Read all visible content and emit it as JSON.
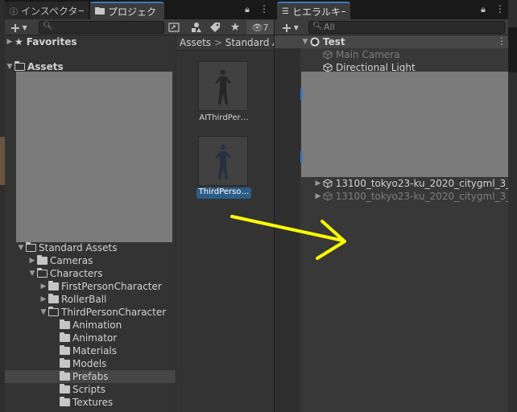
{
  "project": {
    "tabs": [
      {
        "label": "インスペクター",
        "icon": "info-icon"
      },
      {
        "label": "プロジェクト",
        "icon": "folder-icon"
      }
    ],
    "add_button": "+",
    "search_placeholder": "",
    "filter_count": "7",
    "favorites_label": "Favorites",
    "assets_label": "Assets",
    "breadcrumb": [
      "Assets",
      "Standard A"
    ],
    "tree": [
      {
        "label": "Standard Assets",
        "indent": 0,
        "expanded": true,
        "has_arrow": true
      },
      {
        "label": "Cameras",
        "indent": 1,
        "expanded": false,
        "has_arrow": true
      },
      {
        "label": "Characters",
        "indent": 1,
        "expanded": true,
        "has_arrow": true
      },
      {
        "label": "FirstPersonCharacter",
        "indent": 2,
        "expanded": false,
        "has_arrow": true
      },
      {
        "label": "RollerBall",
        "indent": 2,
        "expanded": false,
        "has_arrow": true
      },
      {
        "label": "ThirdPersonCharacter",
        "indent": 2,
        "expanded": true,
        "has_arrow": true
      },
      {
        "label": "Animation",
        "indent": 3,
        "expanded": false,
        "has_arrow": false
      },
      {
        "label": "Animator",
        "indent": 3,
        "expanded": false,
        "has_arrow": false
      },
      {
        "label": "Materials",
        "indent": 3,
        "expanded": false,
        "has_arrow": false
      },
      {
        "label": "Models",
        "indent": 3,
        "expanded": false,
        "has_arrow": false
      },
      {
        "label": "Prefabs",
        "indent": 3,
        "expanded": false,
        "has_arrow": false,
        "selected": true
      },
      {
        "label": "Scripts",
        "indent": 3,
        "expanded": false,
        "has_arrow": false
      },
      {
        "label": "Textures",
        "indent": 3,
        "expanded": false,
        "has_arrow": false
      }
    ],
    "assets": [
      {
        "label": "AIThirdPer…",
        "selected": false
      },
      {
        "label": "ThirdPerso…",
        "selected": true
      }
    ]
  },
  "hierarchy": {
    "tab_label": "ヒエラルキー",
    "add_button": "+",
    "search_placeholder": "All",
    "scene_name": "Test",
    "items": [
      {
        "label": "Main Camera",
        "dimmed": true
      },
      {
        "label": "Directional Light",
        "dimmed": false
      }
    ],
    "citygml_items": [
      {
        "label": "13100_tokyo23-ku_2020_citygml_3_",
        "dimmed": false
      },
      {
        "label": "13100_tokyo23-ku_2020_citygml_3_",
        "dimmed": true
      }
    ]
  },
  "colors": {
    "accent": "#3a79bb",
    "arrow": "#ffff00",
    "selection": "#2c5d87"
  }
}
